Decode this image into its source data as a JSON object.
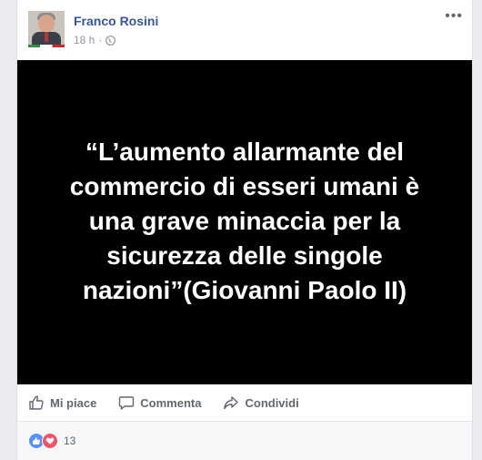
{
  "post": {
    "author": "Franco Rosini",
    "time": "18 h",
    "dot": "·",
    "more": "•••",
    "quote": "“L’aumento allarmante del commercio di esseri umani è una grave minaccia per la sicurezza delle singole nazioni”(Giovanni Paolo II)"
  },
  "actions": {
    "like": "Mi piace",
    "comment": "Commenta",
    "share": "Condividi"
  },
  "reactions": {
    "count": "13",
    "icons": [
      "like-icon",
      "love-icon"
    ]
  },
  "colors": {
    "author_link": "#365899",
    "like_blue": "#5890ff",
    "love_red": "#f25268",
    "media_bg": "#000000"
  }
}
